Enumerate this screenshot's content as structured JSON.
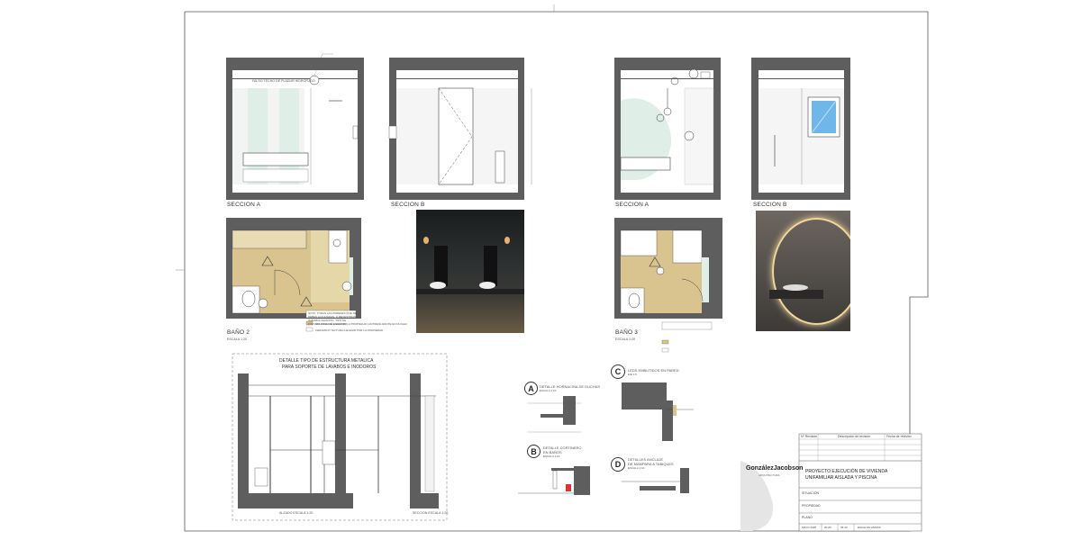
{
  "plan1": {
    "section_a": "SECCION A",
    "section_b": "SECCION B",
    "ceiling_note": "FALSO TECHO DE PLADUR HIDROFUGO",
    "room_title": "BAÑO 2",
    "scale": "ESCALA 1:20",
    "legend": [
      "NOTA: TODAS LAS PAREDES QUE SE DEBEN ALICATADAS, O REVESTIDAS (MÁRMOL/GRANITO, TIPO DE PINTURA Y COLOR A ELEGIR)",
      "SOLERIA A ELEGIR POR LA PROPIEDAD (ANTIDESLIZANTE EN DUCHA)",
      "CERAMICO TEXTURA A ELEGIR POR LA PROPIEDAD"
    ]
  },
  "plan2": {
    "section_a": "SECCION A",
    "section_b": "SECCION B",
    "room_title": "BAÑO 3",
    "scale": "ESCALA 1:20"
  },
  "metal_detail": {
    "title_line1": "DETALLE TIPO DE ESTRUCTURA METALICA",
    "title_line2": "PARA SOPORTE DE LAVABOS E INODOROS",
    "alzado": "ALZADO ESCALA 1:20",
    "seccion": "SECCION ESCALA 1:20"
  },
  "details": {
    "a_letter": "A",
    "a_title": "DETALLE HORNACINA DE DUCHAS",
    "a_scale": "ESCALA 1:10",
    "b_letter": "B",
    "b_title1": "DETALLE CORTINERO",
    "b_title2": "EN BAÑOS",
    "b_scale": "ESCALA 1:10",
    "c_letter": "C",
    "c_title": "LEDS EMBUTIDOS EN PARED",
    "c_scale": "E/E 1:5",
    "d_letter": "D",
    "d_title1": "DETALLES ANCLAJE",
    "d_title2": "DE MAMPARA A TABIQUES",
    "d_scale": "ESCALA 1:10"
  },
  "title_block": {
    "headers": [
      "Nº Revisión",
      "Descripción de revisión",
      "Fecha de revisión"
    ],
    "logo_name": "GonzálezJacobson",
    "logo_sub": "ARQUITECTURA",
    "project_line1": "PROYECTO EJECUCIÓN DE VIVIENDA",
    "project_line2": "UNIFAMILIAR AISLADA Y PISCINA",
    "situacion": "SITUACIÓN",
    "propiedad": "PROPIEDAD",
    "plano": "PLANO",
    "bottom": [
      "MAYO 2025",
      "20-00",
      "02-10",
      "ESCALAS VARIAS"
    ]
  },
  "colors": {
    "wall": "#5e5e5e",
    "floor": "#d9c38e",
    "tile": "#dfeee6",
    "window": "#6fb7e8"
  }
}
